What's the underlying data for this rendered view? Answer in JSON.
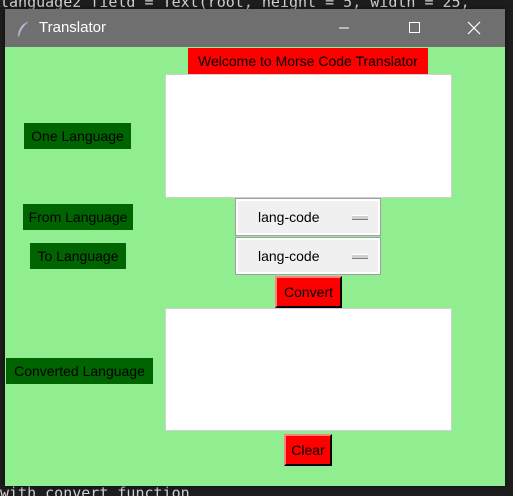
{
  "background_code": {
    "top_line": "language2_field = Text(root, height = 5, width = 25,",
    "bottom_line": "with convert function"
  },
  "window": {
    "title": "Translator",
    "minimize_icon": "minimize-icon",
    "maximize_icon": "maximize-icon",
    "close_icon": "close-icon"
  },
  "heading": "Welcome to Morse Code Translator",
  "labels": {
    "one_language": "One Language",
    "from_language": "From Language",
    "to_language": "To Language",
    "converted_language": "Converted Language"
  },
  "inputs": {
    "one_language_value": "",
    "converted_language_value": ""
  },
  "option_menus": {
    "from": {
      "selected": "lang-code"
    },
    "to": {
      "selected": "lang-code"
    }
  },
  "buttons": {
    "convert": "Convert",
    "clear": "Clear"
  },
  "colors": {
    "window_bg": "#90ee90",
    "heading_bg": "#ff0000",
    "label_bg": "#006400",
    "button_bg": "#ff0000",
    "titlebar_bg": "#6f6f6f"
  }
}
